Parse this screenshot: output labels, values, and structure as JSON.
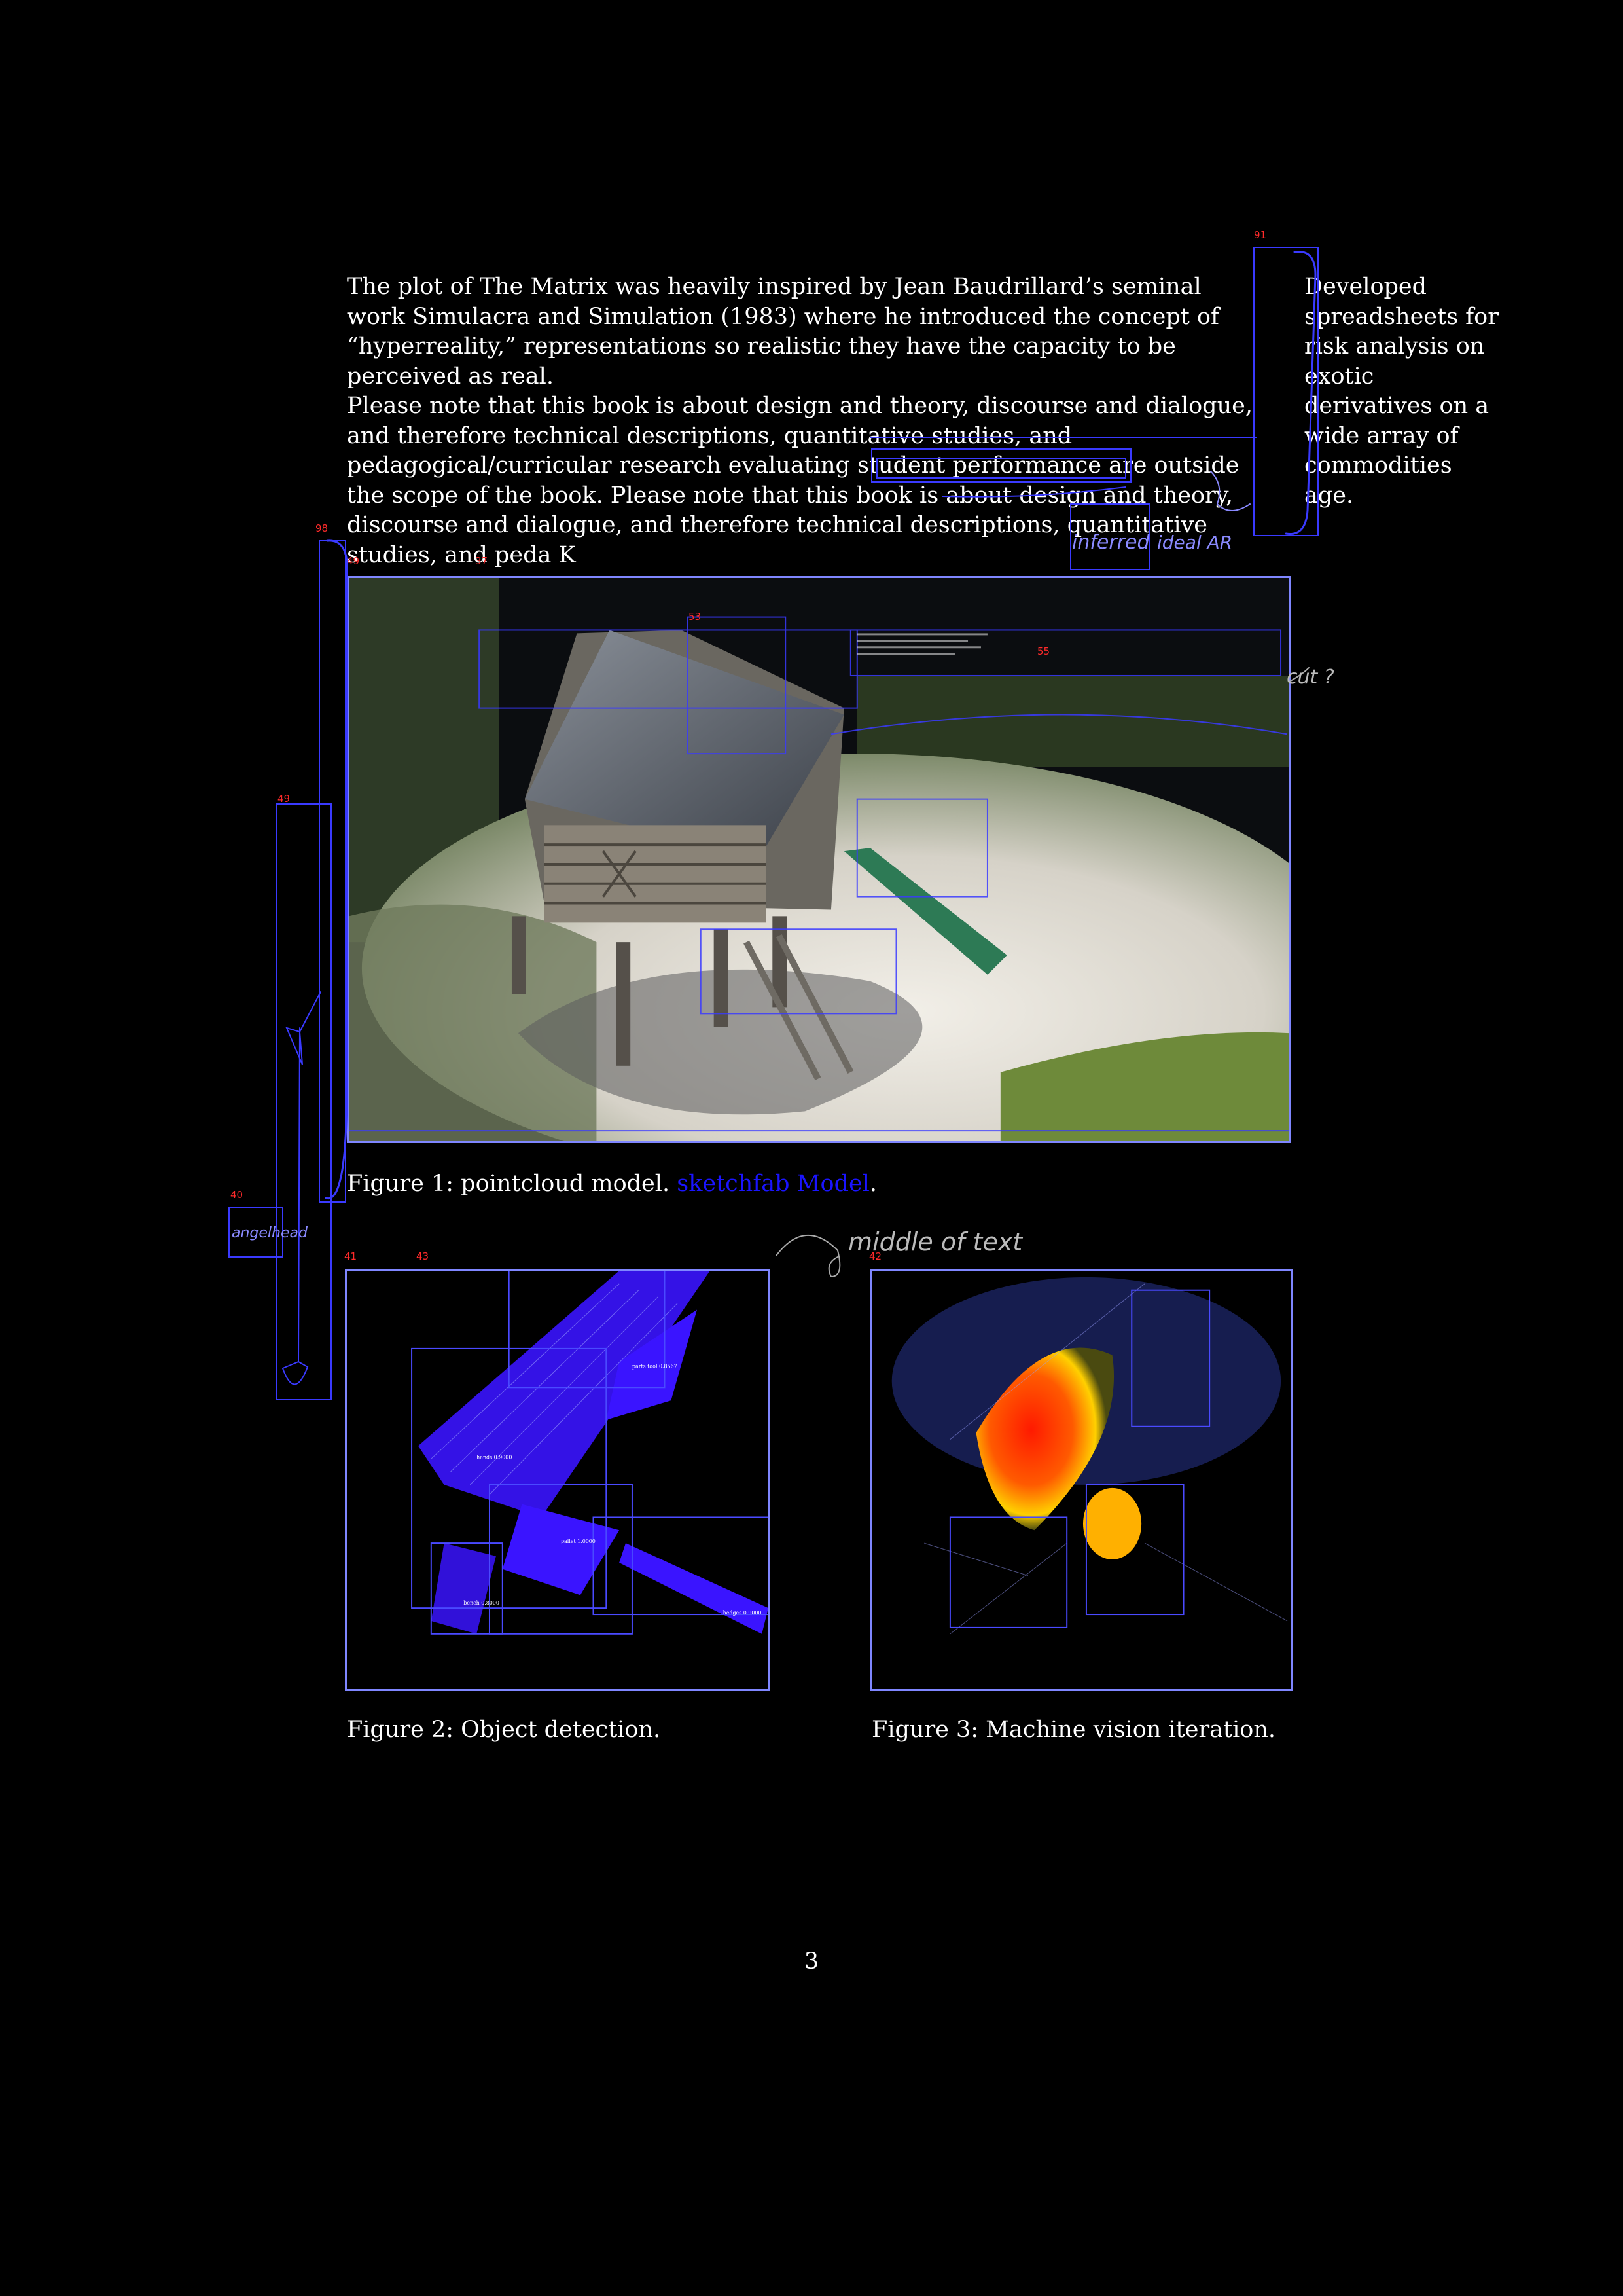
{
  "main_paragraphs": [
    "The plot of The Matrix was heavily inspired by Jean Baudrillard’s seminal work Simulacra and Simulation (1983) where he introduced the concept of “hyperreality,” representations so realistic they have the capacity to be perceived as real.",
    "Please note that this book is about design and theory, discourse and dialogue, and therefore technical descriptions, quantitative studies, and pedagogical/curricular research evaluating student performance are outside the scope of the book. Please note that this book is about design and theory, discourse and dialogue, and therefore technical descriptions, quantitative studies, and peda K"
  ],
  "side_note": "Developed spreadsheets for risk analysis on exotic derivatives on a wide array of commodities age.",
  "figure1": {
    "caption_prefix": "Figure 1: pointcloud model.",
    "caption_link": "sketchfab Model",
    "caption_suffix": "."
  },
  "figure2": {
    "caption": "Figure 2: Object detection."
  },
  "figure3": {
    "caption": "Figure 3: Machine vision iteration."
  },
  "page_number": "3",
  "annotation_numbers": {
    "n91": "91",
    "n98": "98",
    "n49a": "49",
    "n37": "37",
    "n53": "53",
    "n55": "55",
    "n49b": "49",
    "n40": "40",
    "n41": "41",
    "n43": "43",
    "n42": "42"
  },
  "handwriting": {
    "h1": "inferred",
    "h2": "ideal AR",
    "h3": "angelhead",
    "h4": "middle of text",
    "h5": "cut ?"
  },
  "colors": {
    "annotation_blue": "#3a3aff",
    "annotation_red": "#ff2a2a",
    "link_blue": "#1a14ff",
    "frame_blue": "#7f86ff"
  }
}
